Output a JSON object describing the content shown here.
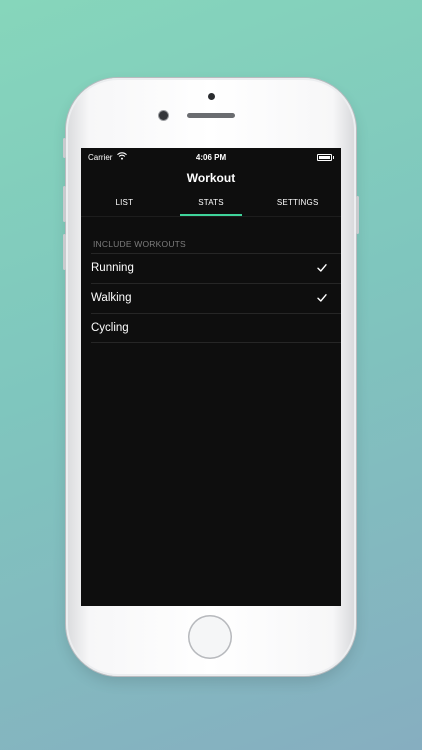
{
  "status_bar": {
    "carrier": "Carrier",
    "time": "4:06 PM",
    "wifi_icon": "wifi-icon",
    "battery_icon": "battery-icon"
  },
  "nav": {
    "title": "Workout"
  },
  "tabs": [
    {
      "label": "LIST",
      "active": false
    },
    {
      "label": "STATS",
      "active": true
    },
    {
      "label": "SETTINGS",
      "active": false
    }
  ],
  "section": {
    "header": "INCLUDE WORKOUTS"
  },
  "workouts": [
    {
      "label": "Running",
      "checked": true
    },
    {
      "label": "Walking",
      "checked": true
    },
    {
      "label": "Cycling",
      "checked": false
    }
  ],
  "colors": {
    "accent": "#3fd39a",
    "screen_bg": "#0e0e0e"
  }
}
